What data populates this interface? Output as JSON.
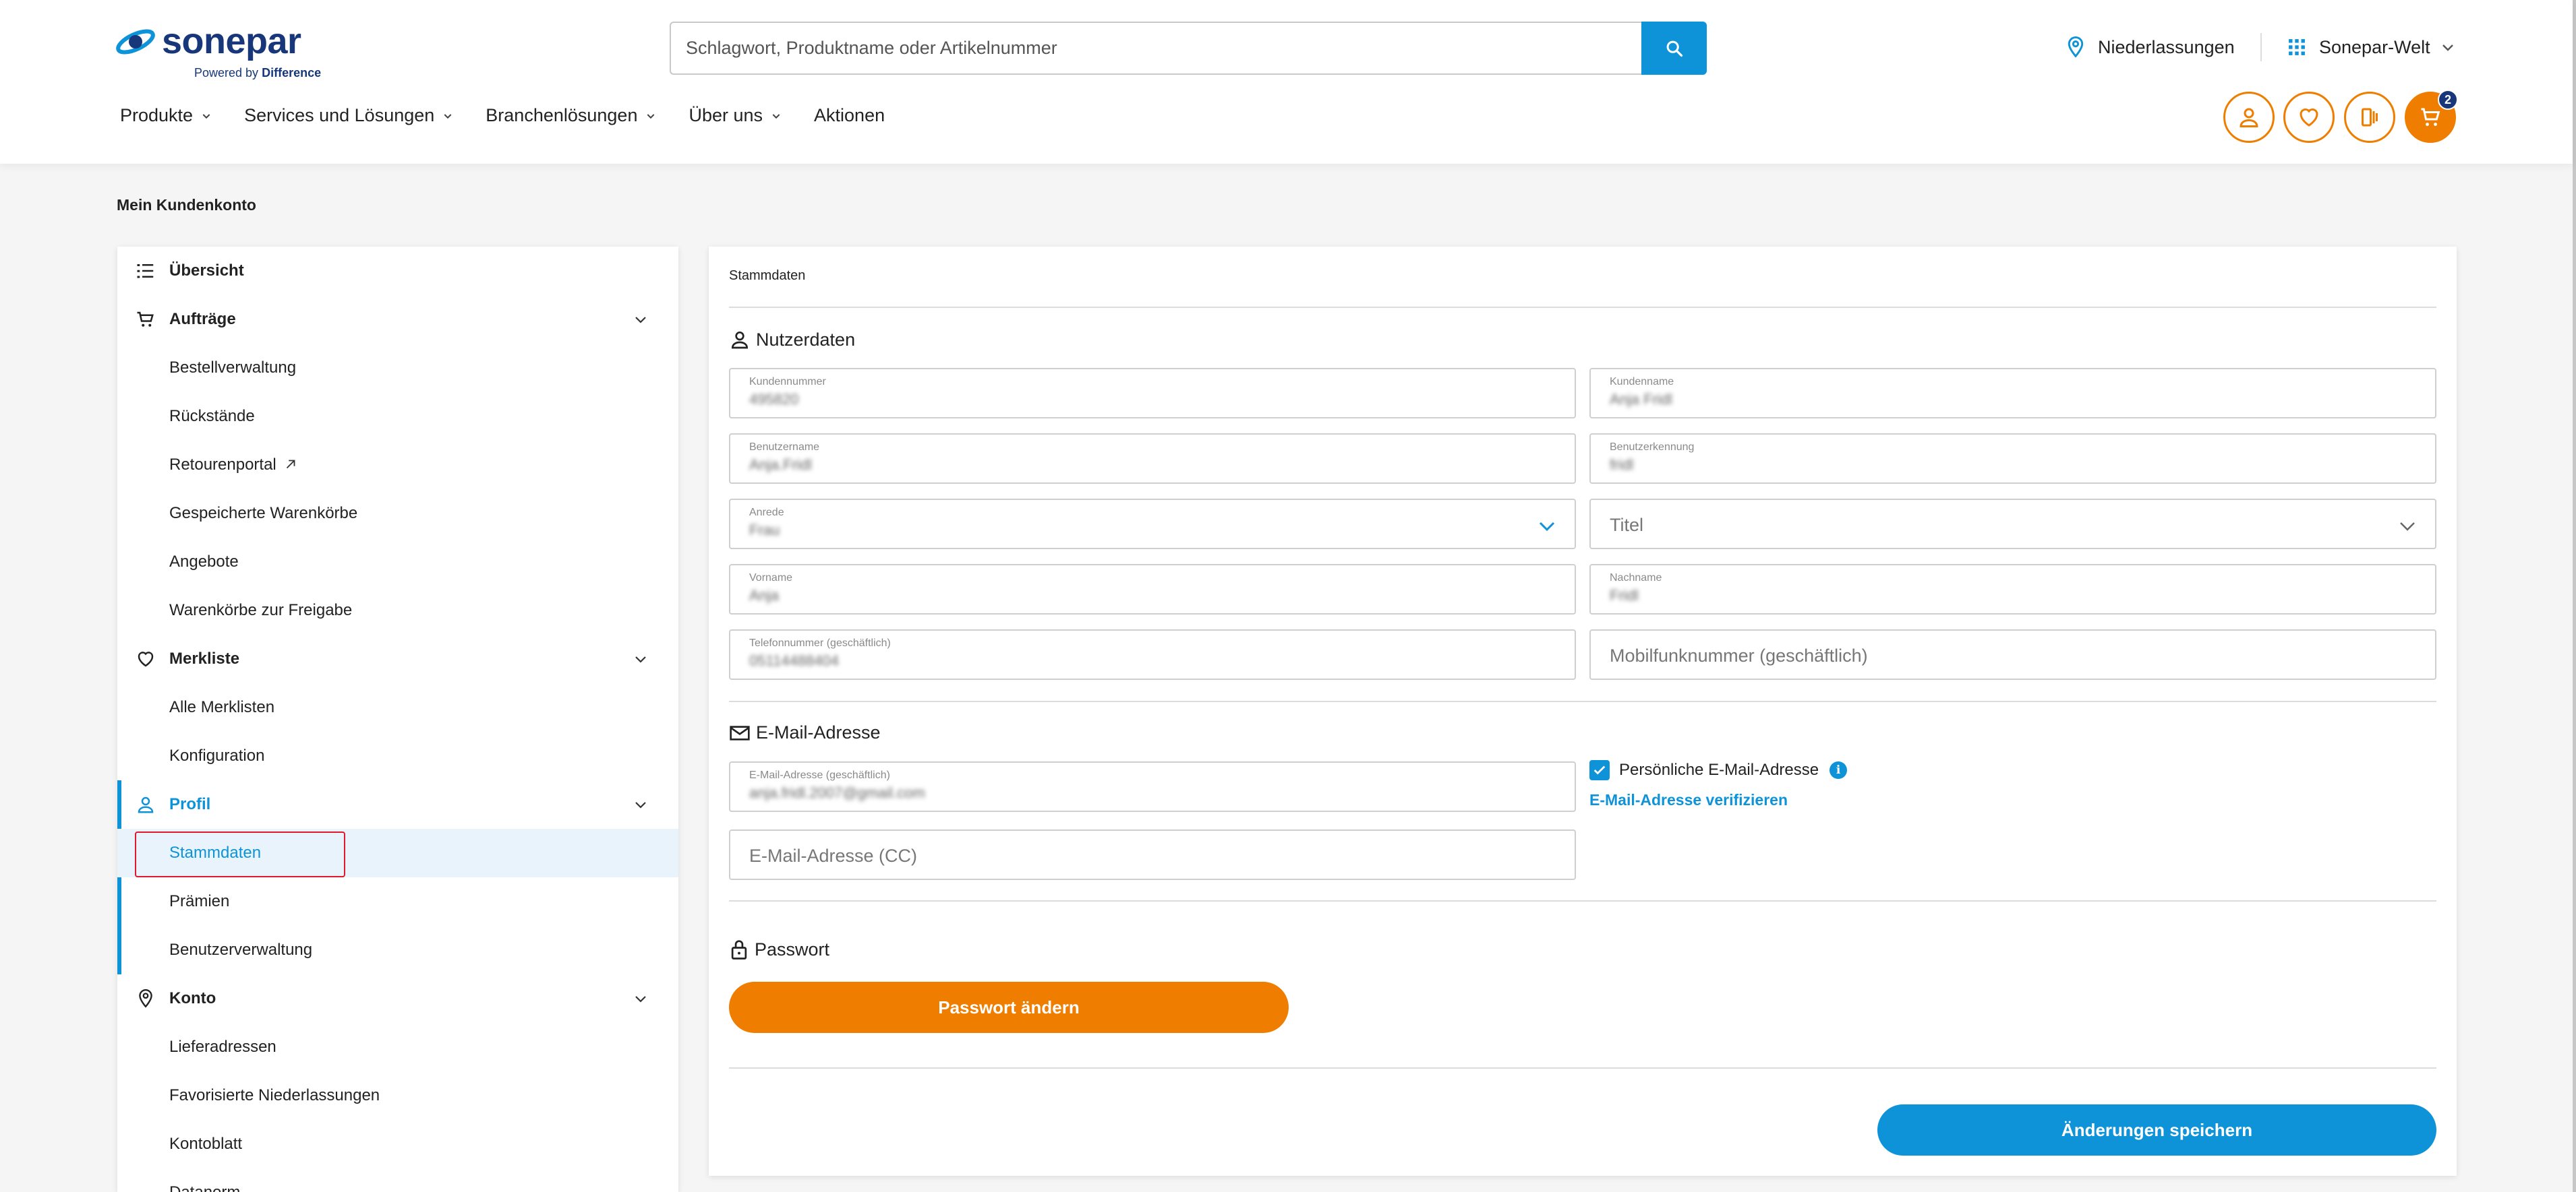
{
  "brand": {
    "name": "sonepar",
    "tagline_prefix": "Powered by",
    "tagline_bold": "Difference",
    "colors": {
      "navy": "#17377a",
      "blue": "#0e93d9",
      "orange": "#ef7d00",
      "alert_red": "#e0182d"
    }
  },
  "search": {
    "placeholder": "Schlagwort, Produktname oder Artikelnummer",
    "icon": "search-icon"
  },
  "header": {
    "branches_label": "Niederlassungen",
    "world_label": "Sonepar-Welt",
    "cart_count": "2",
    "action_icons": [
      "user-icon",
      "heart-icon",
      "compare-icon",
      "cart-icon"
    ]
  },
  "nav": [
    {
      "label": "Produkte",
      "has_dropdown": true
    },
    {
      "label": "Services und Lösungen",
      "has_dropdown": true
    },
    {
      "label": "Branchenlösungen",
      "has_dropdown": true
    },
    {
      "label": "Über uns",
      "has_dropdown": true
    },
    {
      "label": "Aktionen",
      "has_dropdown": false
    }
  ],
  "page_title": "Mein Kundenkonto",
  "sidebar": {
    "overview": "Übersicht",
    "orders": {
      "label": "Aufträge",
      "items": [
        "Bestellverwaltung",
        "Rückstände",
        "Retourenportal",
        "Gespeicherte Warenkörbe",
        "Angebote",
        "Warenkörbe zur Freigabe"
      ]
    },
    "wishlist": {
      "label": "Merkliste",
      "items": [
        "Alle Merklisten",
        "Konfiguration"
      ]
    },
    "profile": {
      "label": "Profil",
      "items": [
        "Stammdaten",
        "Prämien",
        "Benutzerverwaltung"
      ],
      "selected": "Stammdaten"
    },
    "account": {
      "label": "Konto",
      "items": [
        "Lieferadressen",
        "Favorisierte Niederlassungen",
        "Kontoblatt",
        "Datanorm"
      ]
    }
  },
  "content": {
    "title": "Stammdaten",
    "user_section": {
      "title": "Nutzerdaten",
      "customer_number": {
        "label": "Kundennummer",
        "value": "495820"
      },
      "customer_name": {
        "label": "Kundenname",
        "value": "Anja Fridl"
      },
      "username": {
        "label": "Benutzername",
        "value": "Anja.Fridl"
      },
      "user_id": {
        "label": "Benutzerkennung",
        "value": "fridl"
      },
      "salutation": {
        "label": "Anrede",
        "value": "Frau"
      },
      "title_field": {
        "placeholder": "Titel"
      },
      "first_name": {
        "label": "Vorname",
        "value": "Anja"
      },
      "last_name": {
        "label": "Nachname",
        "value": "Fridl"
      },
      "phone": {
        "label": "Telefonnummer (geschäftlich)",
        "value": "05114488404"
      },
      "mobile": {
        "placeholder": "Mobilfunknummer (geschäftlich)"
      }
    },
    "email_section": {
      "title": "E-Mail-Adresse",
      "email": {
        "label": "E-Mail-Adresse (geschäftlich)",
        "value": "anja.fridl.2007@gmail.com"
      },
      "email_cc": {
        "placeholder": "E-Mail-Adresse (CC)"
      },
      "personal_email_checkbox": "Persönliche E-Mail-Adresse",
      "verify_link": "E-Mail-Adresse verifizieren"
    },
    "password_section": {
      "title": "Passwort",
      "change_button": "Passwort ändern"
    },
    "save_button": "Änderungen speichern"
  }
}
